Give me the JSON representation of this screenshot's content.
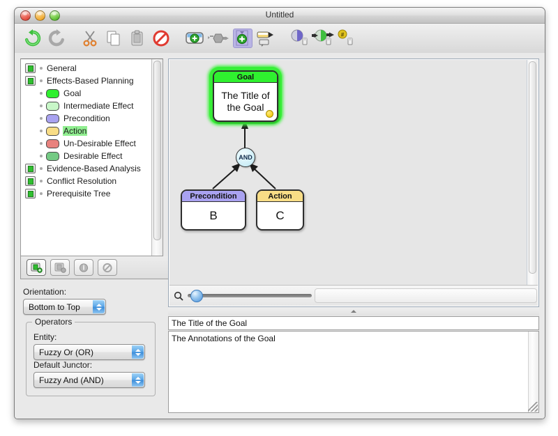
{
  "window": {
    "title": "Untitled",
    "traffic": [
      "close-button",
      "minimize-button",
      "zoom-button"
    ]
  },
  "toolbar": {
    "items": [
      {
        "name": "undo-icon",
        "label": "Undo",
        "selected": false
      },
      {
        "name": "redo-icon",
        "label": "Redo",
        "selected": false
      },
      {
        "name": "cut-icon",
        "label": "Cut",
        "selected": false
      },
      {
        "name": "copy-icon",
        "label": "Copy",
        "selected": false
      },
      {
        "name": "paste-icon",
        "label": "Paste",
        "selected": false
      },
      {
        "name": "delete-icon",
        "label": "Delete",
        "selected": false
      },
      {
        "name": "add-node-icon",
        "label": "Add Node",
        "selected": false
      },
      {
        "name": "add-junctor-icon",
        "label": "Add Junctor",
        "selected": false
      },
      {
        "name": "add-entity-icon",
        "label": "Add Entity",
        "selected": true
      },
      {
        "name": "add-annotation-icon",
        "label": "Add Annotation",
        "selected": false
      },
      {
        "name": "state-icon",
        "label": "State",
        "selected": false
      },
      {
        "name": "transition-icon",
        "label": "Transition",
        "selected": false
      },
      {
        "name": "evidence-icon",
        "label": "Evidence",
        "selected": false
      }
    ]
  },
  "tree": {
    "items": [
      {
        "label": "General",
        "type": "folder",
        "indent": 0,
        "highlight": false
      },
      {
        "label": "Effects-Based Planning",
        "type": "folder",
        "indent": 0,
        "highlight": false
      },
      {
        "label": "Goal",
        "type": "swatch",
        "indent": 1,
        "color": "#2ff02f",
        "highlight": false
      },
      {
        "label": "Intermediate Effect",
        "type": "swatch",
        "indent": 1,
        "color": "#c8f7c8",
        "highlight": false
      },
      {
        "label": "Precondition",
        "type": "swatch",
        "indent": 1,
        "color": "#a9a2f0",
        "highlight": false
      },
      {
        "label": "Action",
        "type": "swatch",
        "indent": 1,
        "color": "#f9dd86",
        "highlight": true
      },
      {
        "label": "Un-Desirable Effect",
        "type": "swatch",
        "indent": 1,
        "color": "#e8827e",
        "highlight": false
      },
      {
        "label": "Desirable Effect",
        "type": "swatch",
        "indent": 1,
        "color": "#74ca84",
        "highlight": false
      },
      {
        "label": "Evidence-Based Analysis",
        "type": "folder",
        "indent": 0,
        "highlight": false
      },
      {
        "label": "Conflict Resolution",
        "type": "folder",
        "indent": 0,
        "highlight": false
      },
      {
        "label": "Prerequisite Tree",
        "type": "folder",
        "indent": 0,
        "highlight": false
      }
    ],
    "buttons": [
      {
        "name": "new-entity-button",
        "label": "New Entity",
        "active": true
      },
      {
        "name": "duplicate-entity-button",
        "label": "Duplicate Entity",
        "active": false
      },
      {
        "name": "info-button",
        "label": "Info",
        "active": false
      },
      {
        "name": "remove-entity-button",
        "label": "Remove Entity",
        "active": false
      }
    ]
  },
  "sidebar": {
    "orientation_label": "Orientation:",
    "orientation_value": "Bottom to Top",
    "operators_legend": "Operators",
    "entity_label": "Entity:",
    "entity_value": "Fuzzy Or (OR)",
    "junctor_label": "Default Junctor:",
    "junctor_value": "Fuzzy And (AND)"
  },
  "diagram": {
    "nodes": [
      {
        "id": "goal",
        "header": "Goal",
        "body": "The Title of the Goal",
        "header_color": "#2ff02f",
        "selected": true,
        "has_dot": true
      },
      {
        "id": "precondition",
        "header": "Precondition",
        "body": "B",
        "header_color": "#a9a2f0",
        "selected": false,
        "has_dot": false
      },
      {
        "id": "action",
        "header": "Action",
        "body": "C",
        "header_color": "#f9dd86",
        "selected": false,
        "has_dot": false
      }
    ],
    "junctor": {
      "label": "AND"
    }
  },
  "inspector": {
    "title_value": "The Title of the Goal",
    "annotation_value": "The Annotations of the Goal"
  },
  "zoom": {
    "slider_position_pct": 4,
    "zoom_out_icon": "magnifier-small-icon",
    "zoom_in_icon": "magnifier-large-icon"
  }
}
